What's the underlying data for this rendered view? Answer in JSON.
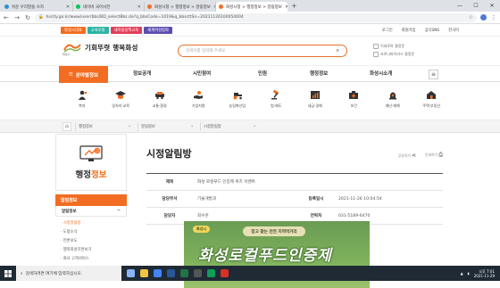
{
  "browser": {
    "tabs": [
      {
        "label": "쉬운 우리말을 쓰자",
        "color": "#2f8fd8"
      },
      {
        "label": "네이버 국어사전",
        "color": "#03c75a"
      },
      {
        "label": "화성시청 > 행정정보 > 알림정보",
        "color": "#f26d21"
      },
      {
        "label": "화성시청 > 행정정보 > 알림정보",
        "color": "#f26d21"
      }
    ],
    "active_tab": 3,
    "new_tab": "+",
    "url": "hscity.go.kr/www/user/bbs/BD_selectBbs.do?q_bbsCode=1019&q_bbscttSn=20211126100054004",
    "window_controls": [
      "—",
      "☐",
      "✕"
    ]
  },
  "site": {
    "top_chips": [
      {
        "label": "화성시대표",
        "color": "#f26d21"
      },
      {
        "label": "교육포털",
        "color": "#2bb3a4"
      },
      {
        "label": "새마을정책교육",
        "color": "#e23e57"
      },
      {
        "label": "세계여성평화",
        "color": "#5b4eb0"
      }
    ],
    "top_links": [
      "로그인",
      "회원가입",
      "공식SNS",
      "한국어"
    ],
    "logo_text": "기회뚜렷 행복화성",
    "logo_sub": "화성시",
    "search_placeholder": "검색어를 입력해 주세요",
    "mini_links": [
      "이세로하 결정문",
      "코로나바이러스 결정문"
    ],
    "gnb_category": "분야별정보",
    "gnb_items": [
      "정보공개",
      "시민참여",
      "민원",
      "행정정보",
      "화성시소개"
    ],
    "quick_menu": [
      {
        "label": "복지",
        "icon": "person-icon"
      },
      {
        "label": "일자리·교육",
        "icon": "graduation-icon"
      },
      {
        "label": "교통·환경",
        "icon": "car-icon"
      },
      {
        "label": "기업지원",
        "icon": "hand-icon"
      },
      {
        "label": "농림축산업",
        "icon": "tractor-icon"
      },
      {
        "label": "법·제도",
        "icon": "gavel-icon"
      },
      {
        "label": "세금·경제",
        "icon": "chart-icon"
      },
      {
        "label": "보건",
        "icon": "medical-icon"
      },
      {
        "label": "재난·재해",
        "icon": "alarm-icon"
      },
      {
        "label": "주택·부동산",
        "icon": "house-icon"
      }
    ],
    "breadcrumb": [
      "행정정보",
      "알림정보",
      "시정알림방"
    ],
    "side": {
      "title_main": "행정",
      "title_accent": "정보",
      "head": "알림정보",
      "sub": "알림정보",
      "items": [
        "시정알림방",
        "도정소식",
        "언론보도",
        "행복화성지면보기",
        "회사 고객서비스"
      ]
    },
    "page_title": "시정알림방",
    "tools": [
      "공유하기",
      "인쇄하기"
    ],
    "post": {
      "subject_label": "제목",
      "subject": "화성 로컬푸드 인증제 퀴즈 이벤트",
      "dept_label": "담당부서",
      "dept": "기술개발과",
      "date_label": "등록일시",
      "date": "2021-11-26 10:04:54",
      "person_label": "담당자",
      "person": "최수훈",
      "tel_label": "연락처",
      "tel": "031-5189-6470"
    },
    "banner": {
      "tag": "화성시",
      "pill": "믿고 찾는 안전 지역먹거리",
      "big": "화성로컬푸드인증제"
    }
  },
  "taskbar": {
    "search": "검색하려면 여기에 입력하십시오.",
    "time": "오후 7:01",
    "date": "2021-11-29"
  }
}
